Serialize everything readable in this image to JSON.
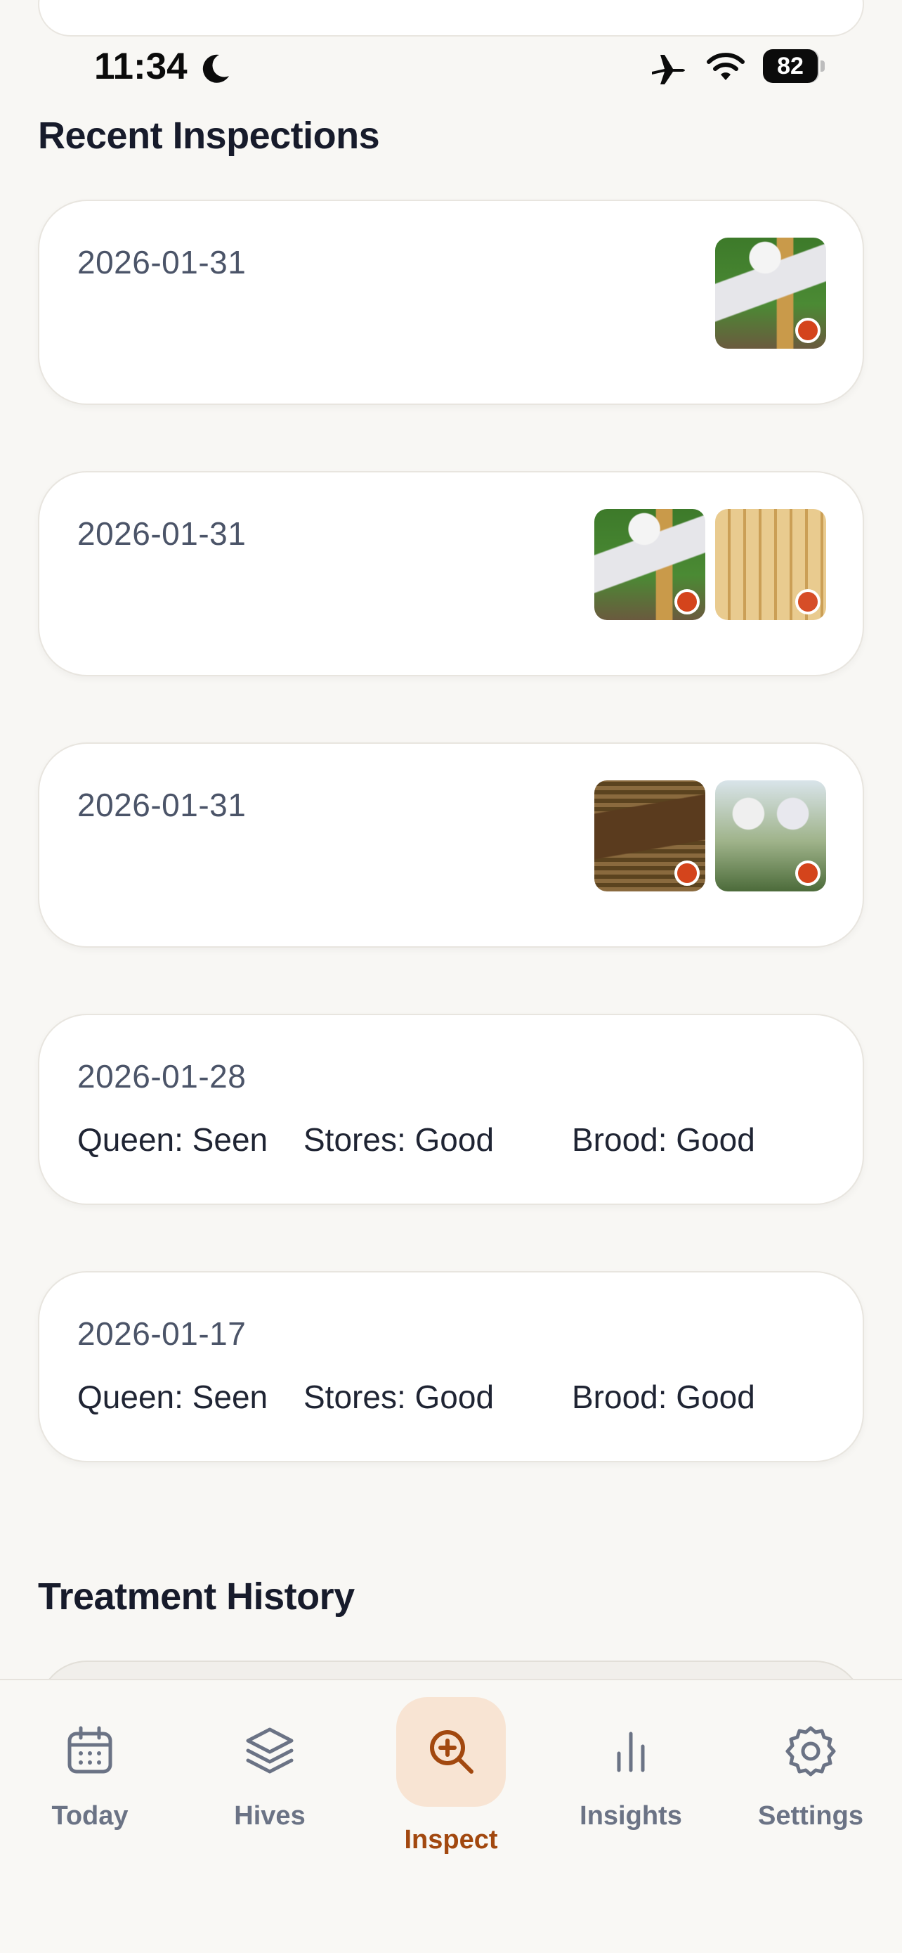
{
  "status_bar": {
    "time": "11:34",
    "battery": "82",
    "icons": [
      "moon-icon",
      "airplane-icon",
      "wifi-icon",
      "battery-icon"
    ]
  },
  "recent_inspections": {
    "title": "Recent Inspections",
    "items": [
      {
        "date": "2026-01-31",
        "photos": 1
      },
      {
        "date": "2026-01-31",
        "photos": 2
      },
      {
        "date": "2026-01-31",
        "photos": 2
      },
      {
        "date": "2026-01-28",
        "queen": "Queen: Seen",
        "stores": "Stores: Good",
        "brood": "Brood: Good"
      },
      {
        "date": "2026-01-17",
        "queen": "Queen: Seen",
        "stores": "Stores: Good",
        "brood": "Brood: Good"
      }
    ]
  },
  "treatment_history": {
    "title": "Treatment History"
  },
  "tab_bar": {
    "tabs": [
      {
        "label": "Today",
        "icon": "calendar-icon"
      },
      {
        "label": "Hives",
        "icon": "layers-icon"
      },
      {
        "label": "Inspect",
        "icon": "search-plus-icon",
        "active": true
      },
      {
        "label": "Insights",
        "icon": "bar-chart-icon"
      },
      {
        "label": "Settings",
        "icon": "gear-icon"
      }
    ]
  },
  "colors": {
    "accent": "#a2480f",
    "accent_bg": "#f8e4d3",
    "photo_dot": "#d4441c",
    "background": "#f8f7f4"
  }
}
